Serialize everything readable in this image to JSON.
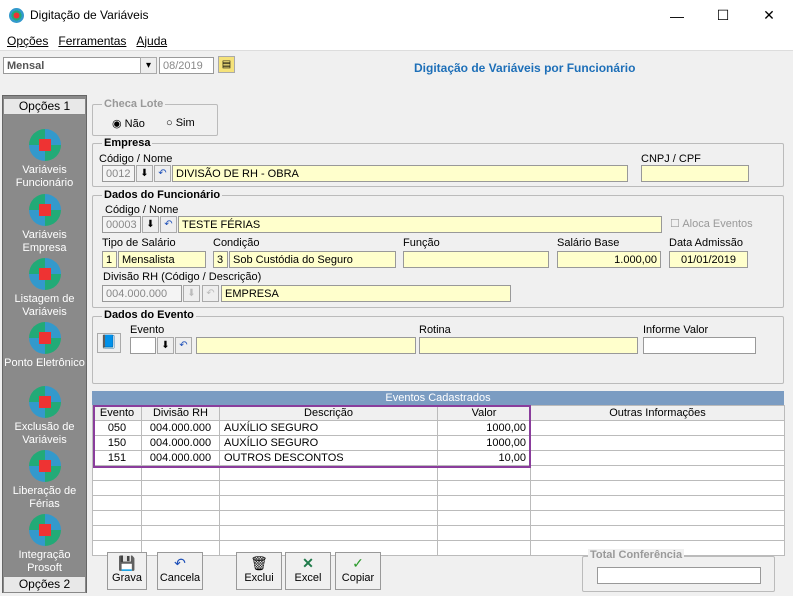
{
  "window": {
    "title": "Digitação de Variáveis",
    "min": "—",
    "max": "☐",
    "close": "✕"
  },
  "menu": [
    "Opções",
    "Ferramentas",
    "Ajuda"
  ],
  "toolbar": {
    "period_type": "Mensal",
    "period": "08/2019",
    "heading": "Digitação de Variáveis por Funcionário"
  },
  "sidebar": {
    "tab1": "Opções 1",
    "tab2": "Opções 2",
    "items": [
      {
        "label": "Variáveis Funcionário"
      },
      {
        "label": "Variáveis Empresa"
      },
      {
        "label": "Listagem de Variáveis"
      },
      {
        "label": "Ponto Eletrônico"
      },
      {
        "label": "Exclusão de Variáveis"
      },
      {
        "label": "Liberação de Férias"
      },
      {
        "label": "Integração Prosoft"
      }
    ]
  },
  "checa_lote": {
    "title": "Checa Lote",
    "opt_nao": "Não",
    "opt_sim": "Sim",
    "selected": "Não"
  },
  "empresa": {
    "title": "Empresa",
    "codigo_label": "Código / Nome",
    "codigo": "0012",
    "nome": "DIVISÃO DE RH - OBRA",
    "cnpj_label": "CNPJ / CPF",
    "cnpj": ""
  },
  "funcionario": {
    "title": "Dados do Funcionário",
    "codigo_label": "Código / Nome",
    "codigo": "00003",
    "nome": "TESTE FÉRIAS",
    "aloca_label": "Aloca Eventos",
    "tipo_label": "Tipo de Salário",
    "tipo_code": "1",
    "tipo": "Mensalista",
    "cond_label": "Condição",
    "cond_code": "3",
    "cond": "Sob Custódia do Seguro",
    "funcao_label": "Função",
    "funcao": "",
    "salario_label": "Salário Base",
    "salario": "1.000,00",
    "adm_label": "Data Admissão",
    "adm": "01/01/2019",
    "div_label": "Divisão RH (Código / Descrição)",
    "div_code": "004.000.000",
    "div": "EMPRESA"
  },
  "evento": {
    "title": "Dados do Evento",
    "evento_label": "Evento",
    "rotina_label": "Rotina",
    "valor_label": "Informe Valor"
  },
  "grid": {
    "band": "Eventos Cadastrados",
    "columns": [
      "Evento",
      "Divisão RH",
      "Descrição",
      "Valor",
      "Outras Informações"
    ],
    "rows": [
      [
        "050",
        "004.000.000",
        "AUXÍLIO SEGURO",
        "1000,00",
        ""
      ],
      [
        "150",
        "004.000.000",
        "AUXÍLIO SEGURO",
        "1000,00",
        ""
      ],
      [
        "151",
        "004.000.000",
        "OUTROS DESCONTOS",
        "10,00",
        ""
      ]
    ]
  },
  "buttons": {
    "grava": "Grava",
    "cancela": "Cancela",
    "exclui": "Exclui",
    "excel": "Excel",
    "copiar": "Copiar"
  },
  "total": {
    "label": "Total Conferência",
    "value": ""
  }
}
